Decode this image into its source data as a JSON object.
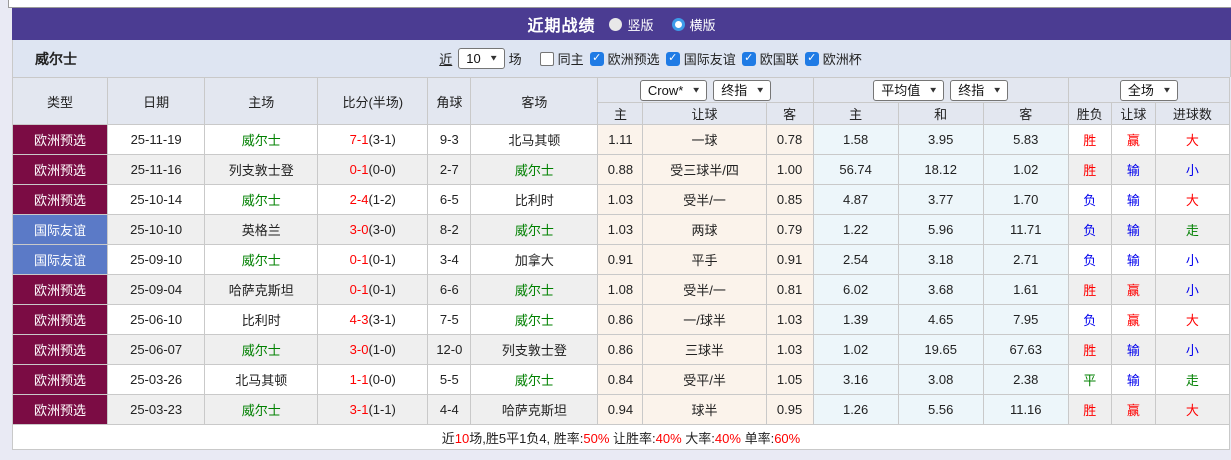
{
  "header": {
    "title": "近期战绩",
    "layout_options": [
      {
        "label": "竖版",
        "checked": false
      },
      {
        "label": "横版",
        "checked": true
      }
    ]
  },
  "filter": {
    "team_name": "威尔士",
    "recent_label": "近",
    "recent_count": "10",
    "games_label": "场",
    "same_home": {
      "label": "同主",
      "checked": false
    },
    "competitions": [
      {
        "label": "欧洲预选",
        "checked": true
      },
      {
        "label": "国际友谊",
        "checked": true
      },
      {
        "label": "欧国联",
        "checked": true
      },
      {
        "label": "欧洲杯",
        "checked": true
      }
    ]
  },
  "table": {
    "col_headers": [
      "类型",
      "日期",
      "主场",
      "比分(半场)",
      "角球",
      "客场"
    ],
    "selects": {
      "bookmaker": "Crow*",
      "odds_stage": "终指",
      "average": "平均值",
      "average_stage": "终指",
      "scope": "全场"
    },
    "sub_headers": [
      "主",
      "让球",
      "客",
      "主",
      "和",
      "客",
      "胜负",
      "让球",
      "进球数"
    ],
    "rows": [
      {
        "type": "欧洲预选",
        "type_cls": "type-maroon",
        "date": "25-11-19",
        "home": "威尔士",
        "home_cls": "green",
        "score": "7-1",
        "half": "(3-1)",
        "corner": "9-3",
        "away": "北马其顿",
        "away_cls": "",
        "h_odds": "1.11",
        "line": "一球",
        "a_odds": "0.78",
        "avg_h": "1.58",
        "avg_d": "3.95",
        "avg_a": "5.83",
        "res": "胜",
        "res_cls": "red",
        "hres": "赢",
        "hres_cls": "red",
        "goal": "大",
        "goal_cls": "red"
      },
      {
        "type": "欧洲预选",
        "type_cls": "type-maroon",
        "date": "25-11-16",
        "home": "列支敦士登",
        "home_cls": "",
        "score": "0-1",
        "half": "(0-0)",
        "corner": "2-7",
        "away": "威尔士",
        "away_cls": "green",
        "h_odds": "0.88",
        "line": "受三球半/四",
        "a_odds": "1.00",
        "avg_h": "56.74",
        "avg_d": "18.12",
        "avg_a": "1.02",
        "res": "胜",
        "res_cls": "red",
        "hres": "输",
        "hres_cls": "blue",
        "goal": "小",
        "goal_cls": "blue"
      },
      {
        "type": "欧洲预选",
        "type_cls": "type-maroon",
        "date": "25-10-14",
        "home": "威尔士",
        "home_cls": "green",
        "score": "2-4",
        "half": "(1-2)",
        "corner": "6-5",
        "away": "比利时",
        "away_cls": "",
        "h_odds": "1.03",
        "line": "受半/一",
        "a_odds": "0.85",
        "avg_h": "4.87",
        "avg_d": "3.77",
        "avg_a": "1.70",
        "res": "负",
        "res_cls": "blue",
        "hres": "输",
        "hres_cls": "blue",
        "goal": "大",
        "goal_cls": "red"
      },
      {
        "type": "国际友谊",
        "type_cls": "type-blue",
        "date": "25-10-10",
        "home": "英格兰",
        "home_cls": "",
        "score": "3-0",
        "half": "(3-0)",
        "corner": "8-2",
        "away": "威尔士",
        "away_cls": "green",
        "h_odds": "1.03",
        "line": "两球",
        "a_odds": "0.79",
        "avg_h": "1.22",
        "avg_d": "5.96",
        "avg_a": "11.71",
        "res": "负",
        "res_cls": "blue",
        "hres": "输",
        "hres_cls": "blue",
        "goal": "走",
        "goal_cls": "green"
      },
      {
        "type": "国际友谊",
        "type_cls": "type-blue",
        "date": "25-09-10",
        "home": "威尔士",
        "home_cls": "green",
        "score": "0-1",
        "half": "(0-1)",
        "corner": "3-4",
        "away": "加拿大",
        "away_cls": "",
        "h_odds": "0.91",
        "line": "平手",
        "a_odds": "0.91",
        "avg_h": "2.54",
        "avg_d": "3.18",
        "avg_a": "2.71",
        "res": "负",
        "res_cls": "blue",
        "hres": "输",
        "hres_cls": "blue",
        "goal": "小",
        "goal_cls": "blue"
      },
      {
        "type": "欧洲预选",
        "type_cls": "type-maroon",
        "date": "25-09-04",
        "home": "哈萨克斯坦",
        "home_cls": "",
        "score": "0-1",
        "half": "(0-1)",
        "corner": "6-6",
        "away": "威尔士",
        "away_cls": "green",
        "h_odds": "1.08",
        "line": "受半/一",
        "a_odds": "0.81",
        "avg_h": "6.02",
        "avg_d": "3.68",
        "avg_a": "1.61",
        "res": "胜",
        "res_cls": "red",
        "hres": "赢",
        "hres_cls": "red",
        "goal": "小",
        "goal_cls": "blue"
      },
      {
        "type": "欧洲预选",
        "type_cls": "type-maroon",
        "date": "25-06-10",
        "home": "比利时",
        "home_cls": "",
        "score": "4-3",
        "half": "(3-1)",
        "corner": "7-5",
        "away": "威尔士",
        "away_cls": "green",
        "h_odds": "0.86",
        "line": "一/球半",
        "a_odds": "1.03",
        "avg_h": "1.39",
        "avg_d": "4.65",
        "avg_a": "7.95",
        "res": "负",
        "res_cls": "blue",
        "hres": "赢",
        "hres_cls": "red",
        "goal": "大",
        "goal_cls": "red"
      },
      {
        "type": "欧洲预选",
        "type_cls": "type-maroon",
        "date": "25-06-07",
        "home": "威尔士",
        "home_cls": "green",
        "score": "3-0",
        "half": "(1-0)",
        "corner": "12-0",
        "away": "列支敦士登",
        "away_cls": "",
        "h_odds": "0.86",
        "line": "三球半",
        "a_odds": "1.03",
        "avg_h": "1.02",
        "avg_d": "19.65",
        "avg_a": "67.63",
        "res": "胜",
        "res_cls": "red",
        "hres": "输",
        "hres_cls": "blue",
        "goal": "小",
        "goal_cls": "blue"
      },
      {
        "type": "欧洲预选",
        "type_cls": "type-maroon",
        "date": "25-03-26",
        "home": "北马其顿",
        "home_cls": "",
        "score": "1-1",
        "half": "(0-0)",
        "corner": "5-5",
        "away": "威尔士",
        "away_cls": "green",
        "h_odds": "0.84",
        "line": "受平/半",
        "a_odds": "1.05",
        "avg_h": "3.16",
        "avg_d": "3.08",
        "avg_a": "2.38",
        "res": "平",
        "res_cls": "green",
        "hres": "输",
        "hres_cls": "blue",
        "goal": "走",
        "goal_cls": "green"
      },
      {
        "type": "欧洲预选",
        "type_cls": "type-maroon",
        "date": "25-03-23",
        "home": "威尔士",
        "home_cls": "green",
        "score": "3-1",
        "half": "(1-1)",
        "corner": "4-4",
        "away": "哈萨克斯坦",
        "away_cls": "",
        "h_odds": "0.94",
        "line": "球半",
        "a_odds": "0.95",
        "avg_h": "1.26",
        "avg_d": "5.56",
        "avg_a": "11.16",
        "res": "胜",
        "res_cls": "red",
        "hres": "赢",
        "hres_cls": "red",
        "goal": "大",
        "goal_cls": "red"
      }
    ]
  },
  "footer": {
    "parts": [
      {
        "text": "近",
        "cls": ""
      },
      {
        "text": "10",
        "cls": "red"
      },
      {
        "text": "场,胜5平1负4, 胜率:",
        "cls": ""
      },
      {
        "text": "50%",
        "cls": "red"
      },
      {
        "text": " 让胜率:",
        "cls": ""
      },
      {
        "text": "40%",
        "cls": "red"
      },
      {
        "text": " 大率:",
        "cls": ""
      },
      {
        "text": "40%",
        "cls": "red"
      },
      {
        "text": " 单率:",
        "cls": ""
      },
      {
        "text": "60%",
        "cls": "red"
      }
    ]
  },
  "colors": {
    "header_purple": "#4B3C92",
    "badge_maroon": "#7B0C44",
    "badge_blue": "#5B7AC7",
    "win_red": "#FF0000",
    "lose_blue": "#0000EE",
    "draw_green": "#008000",
    "handicap_bg": "#FBF3EB",
    "average_bg": "#EDF6FA"
  }
}
